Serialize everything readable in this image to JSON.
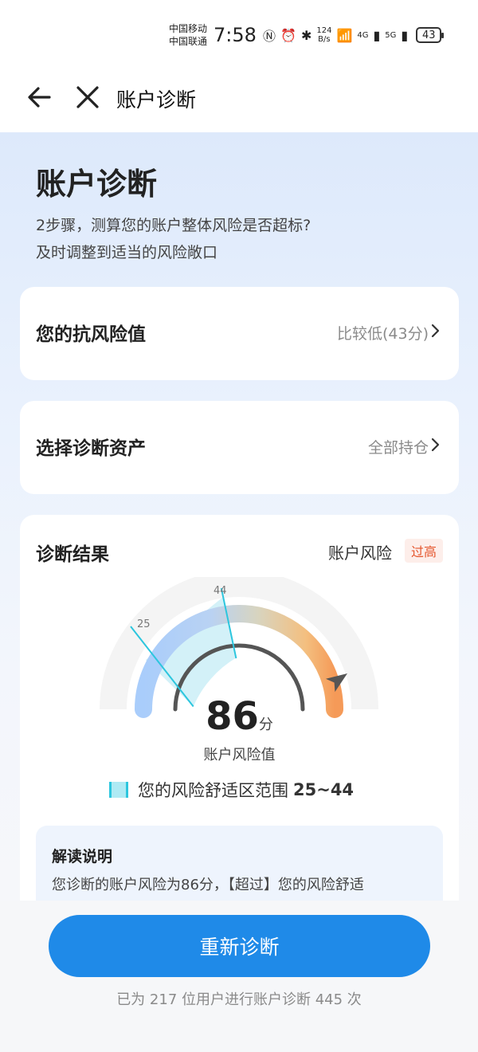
{
  "status_bar": {
    "carrier_1": "中国移动",
    "carrier_2": "中国联通",
    "time": "7:58",
    "net_speed_value": "124",
    "net_speed_unit": "B/s",
    "net_type_1": "4G",
    "net_type_2": "5G",
    "battery": "43"
  },
  "nav": {
    "title": "账户诊断"
  },
  "header": {
    "title": "账户诊断",
    "desc_line1": "2步骤，测算您的账户整体风险是否超标?",
    "desc_line2": "及时调整到适当的风险敞口"
  },
  "rows": [
    {
      "label": "您的抗风险值",
      "value": "比较低(43分)"
    },
    {
      "label": "选择诊断资产",
      "value": "全部持仓"
    }
  ],
  "result": {
    "title": "诊断结果",
    "risk_label": "账户风险",
    "risk_badge": "过高",
    "score": "86",
    "score_unit": "分",
    "score_caption": "账户风险值",
    "score_value": 86,
    "gauge_min_marker": "25",
    "gauge_max_marker": "44",
    "comfort_text": "您的风险舒适区范围",
    "comfort_range": "25~44",
    "explain_title": "解读说明",
    "explain_text": "您诊断的账户风险为86分，【超过】您的风险舒适"
  },
  "actions": {
    "rediagnose": "重新诊断",
    "footer_note": "已为 217 位用户进行账户诊断 445 次"
  },
  "colors": {
    "primary": "#1f8ae8",
    "danger": "#e5562d",
    "comfort_zone": "#aeeaf4"
  }
}
